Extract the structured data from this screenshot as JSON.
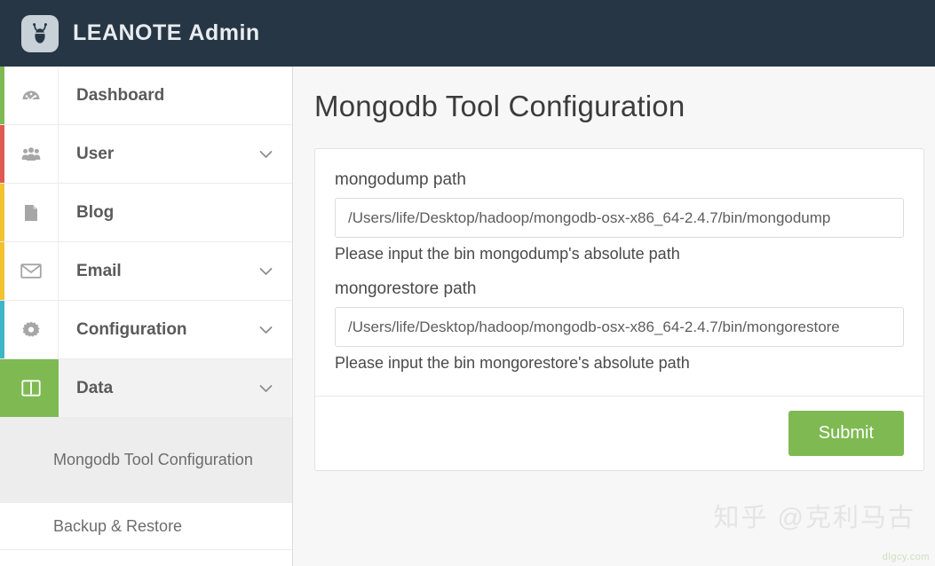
{
  "header": {
    "logo_icon": "beetle-logo-icon",
    "brand_name": "LEANOTE",
    "brand_sub": "Admin",
    "bg_color": "#263645"
  },
  "sidebar": {
    "items": [
      {
        "label": "Dashboard",
        "icon": "dashboard-gauge-icon",
        "accent": "#7eba51",
        "has_chevron": false,
        "active": false
      },
      {
        "label": "User",
        "icon": "users-group-icon",
        "accent": "#e05a52",
        "has_chevron": true,
        "active": false
      },
      {
        "label": "Blog",
        "icon": "document-page-icon",
        "accent": "#f2c230",
        "has_chevron": false,
        "active": false
      },
      {
        "label": "Email",
        "icon": "envelope-icon",
        "accent": "#f2c230",
        "has_chevron": true,
        "active": false
      },
      {
        "label": "Configuration",
        "icon": "gear-icon",
        "accent": "#3fb6c8",
        "has_chevron": true,
        "active": false
      },
      {
        "label": "Data",
        "icon": "columns-layout-icon",
        "accent": "#7eba51",
        "has_chevron": true,
        "active": true
      }
    ],
    "submenu": [
      {
        "label": "Mongodb Tool Configuration",
        "active": true
      },
      {
        "label": "Backup & Restore",
        "active": false
      }
    ],
    "chevron_icon": "chevron-down-icon"
  },
  "main": {
    "page_title": "Mongodb Tool Configuration",
    "form": {
      "fields": [
        {
          "label": "mongodump path",
          "value": "/Users/life/Desktop/hadoop/mongodb-osx-x86_64-2.4.7/bin/mongodump",
          "placeholder": "mongodump path",
          "help": "Please input the bin mongodump's absolute path"
        },
        {
          "label": "mongorestore path",
          "value": "/Users/life/Desktop/hadoop/mongodb-osx-x86_64-2.4.7/bin/mongorestore",
          "placeholder": "mongorestore path",
          "help": "Please input the bin mongorestore's absolute path"
        }
      ],
      "submit_label": "Submit",
      "submit_color": "#7eba51"
    }
  },
  "watermark": {
    "text": "知乎 @克利马古",
    "small_text": "dlgcy.com"
  }
}
